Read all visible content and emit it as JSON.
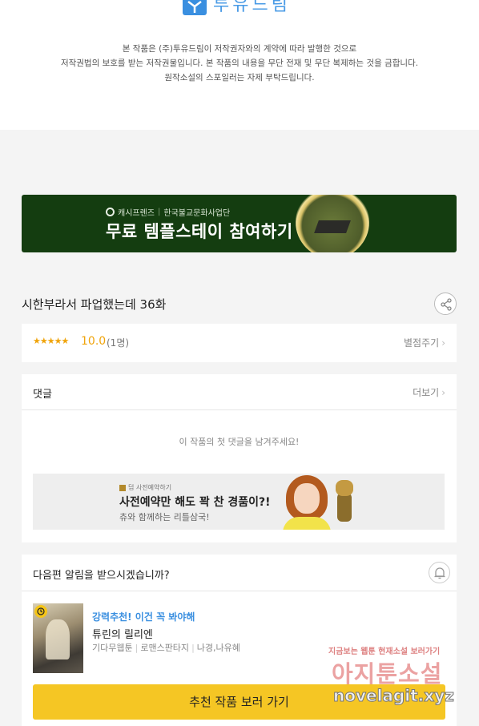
{
  "header": {
    "logo_text": "투유드림",
    "copyright_lines": [
      "본 작품은 (주)투유드림이 저작권자와의 계약에 따라 발행한 것으로",
      "저작권법의 보호를 받는 저작권물입니다. 본 작품의 내용을 무단 전재 및 무단 복제하는 것을 금합니다.",
      "원작소설의 스포일러는 자제 부탁드립니다."
    ]
  },
  "banner": {
    "brand": "캐시프렌즈",
    "partner": "한국불교문화사업단",
    "title": "무료 템플스테이 참여하기"
  },
  "episode": {
    "title": "시한부라서 파업했는데 36화"
  },
  "rating": {
    "stars": "★★★★★",
    "score": "10.0",
    "count": "(1명)",
    "rate_label": "별점주기"
  },
  "comments": {
    "label": "댓글",
    "more_label": "더보기",
    "empty_text": "이 작품의 첫 댓글을 남겨주세요!"
  },
  "ad": {
    "tag": "덤 사전예약하기",
    "headline": "사전예약만 해도 꽉 찬 경품이?!",
    "sub": "츄와 함께하는 리틀삼국!"
  },
  "notify": {
    "label": "다음편 알림을 받으시겠습니까?"
  },
  "recommend": {
    "tag": "강력추천! 이건 꼭 봐야해",
    "title": "튜린의 릴리엔",
    "meta": [
      "기다무웹툰",
      "로맨스판타지",
      "나경,나유혜"
    ],
    "cta": "추천 작품 보러 가기"
  },
  "watermark": {
    "small": "지금보는 웹툰 현재소설 보러가기",
    "big": "아지툰소설",
    "url": "novelagit.xyz"
  },
  "colors": {
    "accent_blue": "#3a8fe0",
    "star_orange": "#f0a40b",
    "cta_yellow": "#f5c624",
    "banner_green": "#143d10"
  }
}
